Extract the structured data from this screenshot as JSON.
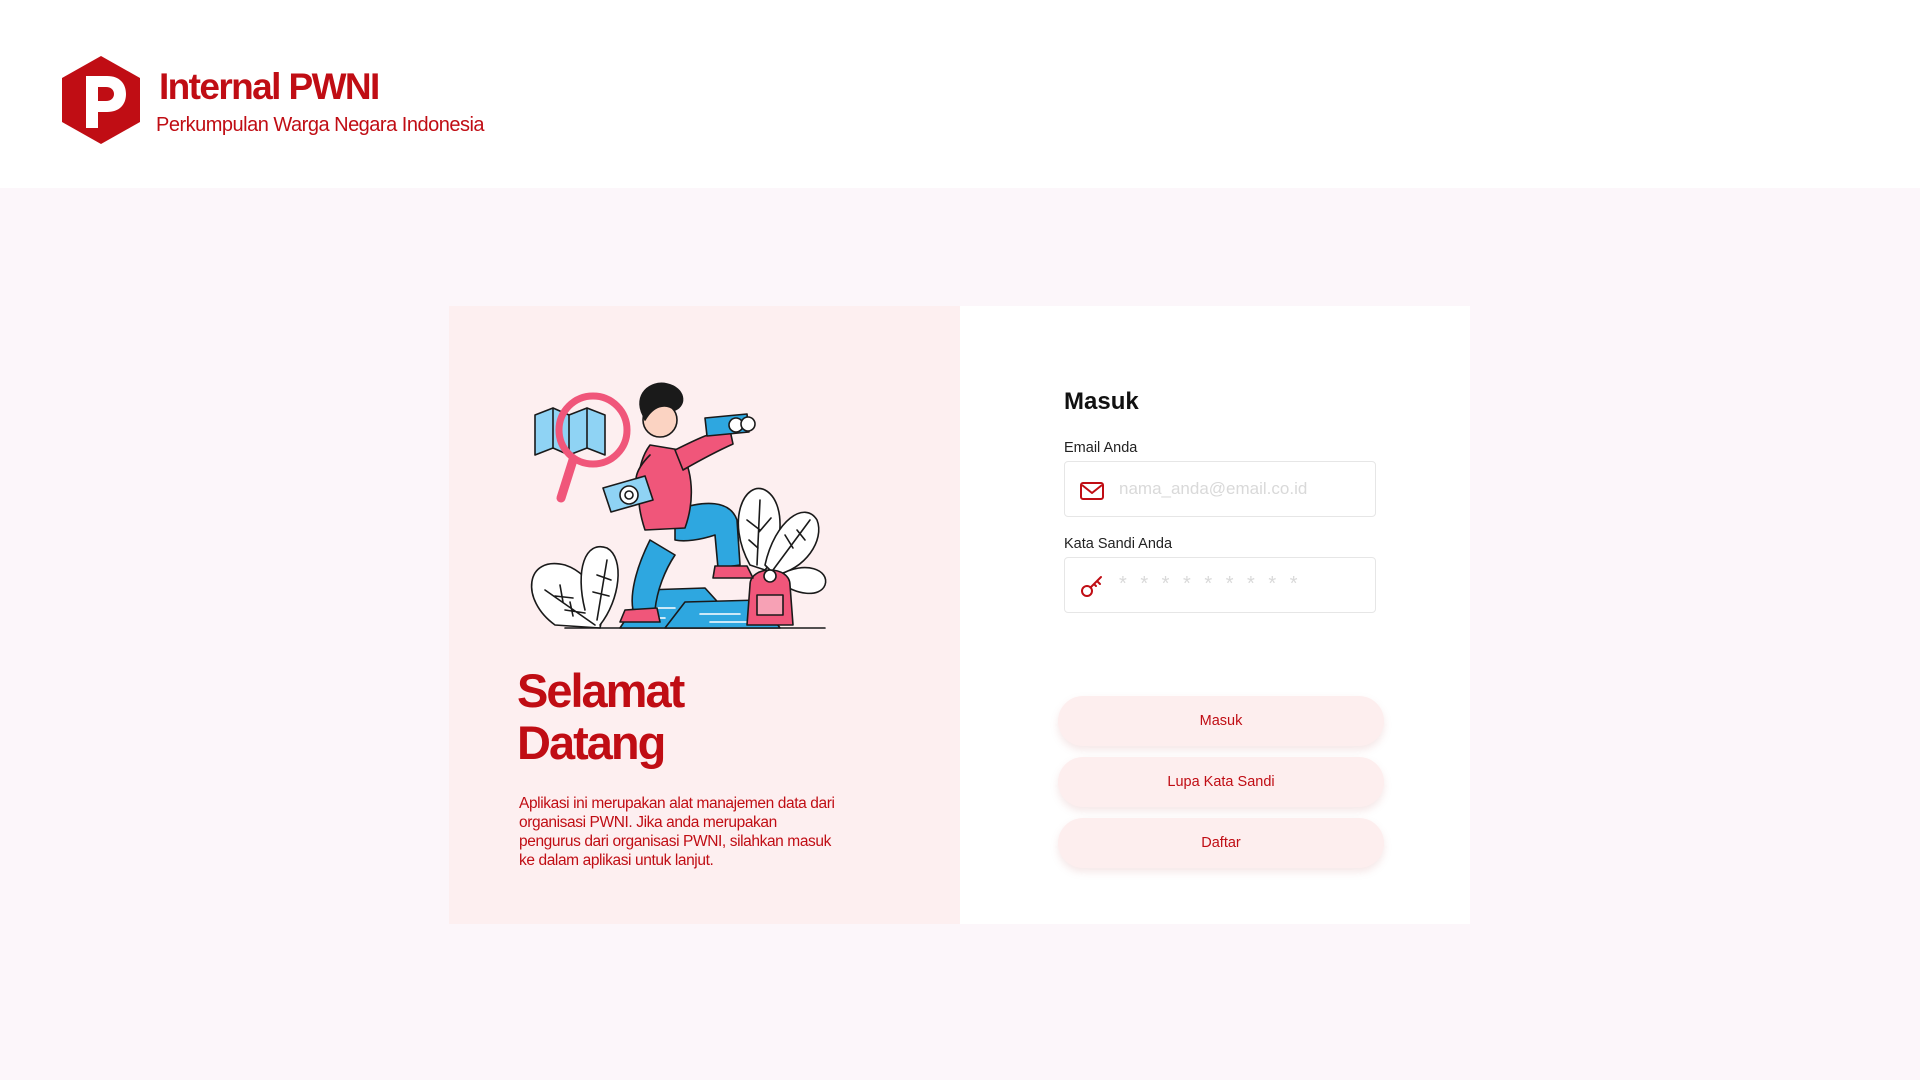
{
  "brand": {
    "title": "Internal PWNI",
    "subtitle": "Perkumpulan Warga Negara Indonesia",
    "logo_icon": "pwni-logo-icon"
  },
  "welcome": {
    "heading": "Selamat Datang",
    "description": "Aplikasi ini merupakan alat manajemen data dari organisasi PWNI. Jika anda merupakan pengurus dari organisasi PWNI, silahkan masuk ke dalam aplikasi untuk lanjut.",
    "illustration": "explorer-with-binoculars-illustration"
  },
  "login_form": {
    "title": "Masuk",
    "email": {
      "label": "Email Anda",
      "placeholder": "nama_anda@email.co.id",
      "value": "",
      "icon": "envelope-icon"
    },
    "password": {
      "label": "Kata Sandi Anda",
      "placeholder": "* * * * * * * * *",
      "value": "",
      "icon": "key-icon"
    },
    "buttons": {
      "login": "Masuk",
      "forgot": "Lupa Kata Sandi",
      "register": "Daftar"
    }
  },
  "colors": {
    "brand_red": "#C00D14",
    "page_bg": "#FCF6FA",
    "panel_pink": "#FDEFF0",
    "button_bg": "#FDEEEE"
  }
}
